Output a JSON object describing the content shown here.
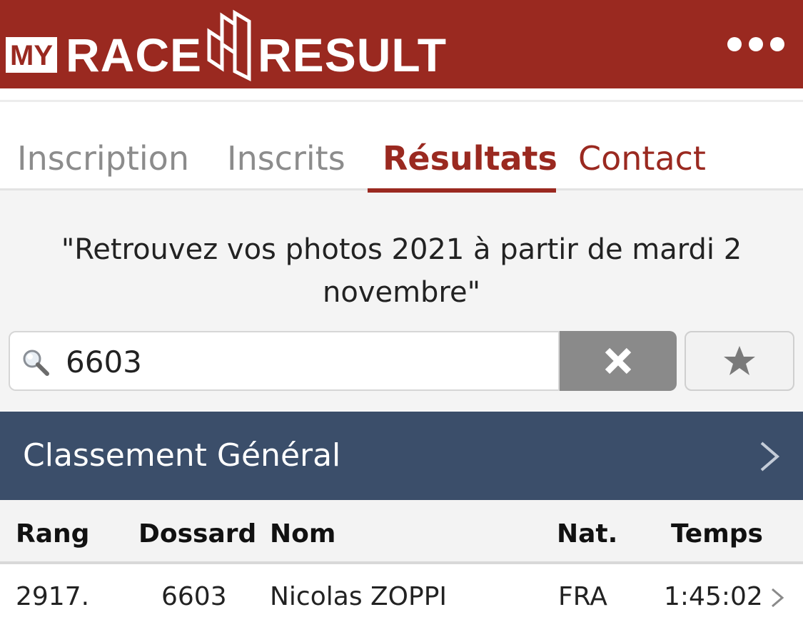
{
  "header": {
    "logo_my": "MY",
    "logo_race": "RACE",
    "logo_result": "RESULT",
    "menu_icon": "more-dots-icon"
  },
  "tabs": [
    {
      "label": "Inscription",
      "active": false
    },
    {
      "label": "Inscrits",
      "active": false
    },
    {
      "label": "Résultats",
      "active": true
    },
    {
      "label": "Contact",
      "active": false
    }
  ],
  "notice": "\"Retrouvez vos photos 2021 à partir de mardi 2 novembre\"",
  "search": {
    "value": "6603",
    "icon": "search-icon",
    "clear_icon": "close-icon",
    "favorite_icon": "star-icon"
  },
  "section": {
    "title": "Classement Général",
    "icon": "chevron-right-icon"
  },
  "table": {
    "columns": [
      "Rang",
      "Dossard",
      "Nom",
      "Nat.",
      "Temps"
    ],
    "rows": [
      {
        "rang": "2917.",
        "dossard": "6603",
        "nom": "Nicolas ZOPPI",
        "nat": "FRA",
        "temps": "1:45:02"
      }
    ]
  },
  "colors": {
    "brand_red": "#9a2920",
    "section_blue": "#3b4e6a",
    "clear_button_grey": "#8a8a8a"
  }
}
